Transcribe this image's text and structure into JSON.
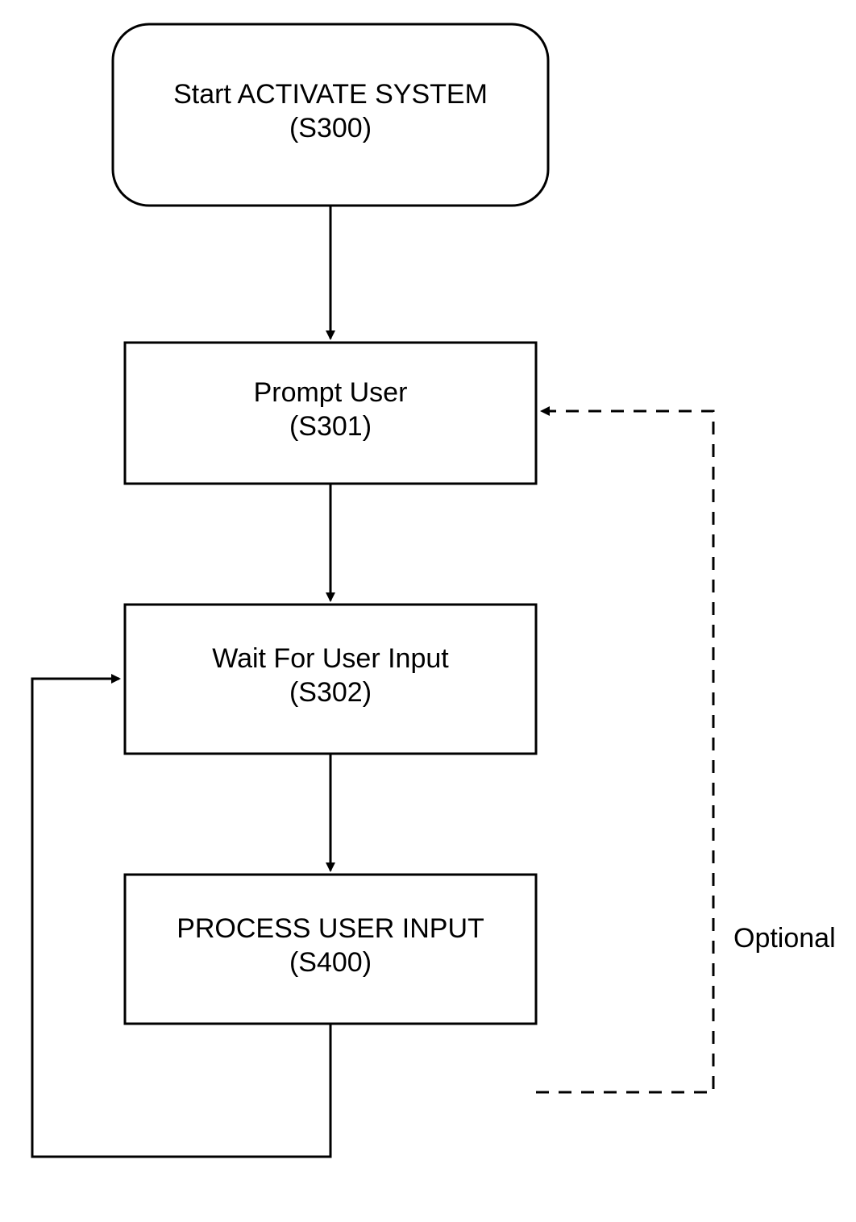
{
  "nodes": {
    "start": {
      "line1": "Start ACTIVATE SYSTEM",
      "line2": "(S300)"
    },
    "prompt": {
      "line1": "Prompt User",
      "line2": "(S301)"
    },
    "wait": {
      "line1": "Wait For User Input",
      "line2": "(S302)"
    },
    "process": {
      "line1": "PROCESS USER INPUT",
      "line2": "(S400)"
    }
  },
  "labels": {
    "optional": "Optional"
  }
}
